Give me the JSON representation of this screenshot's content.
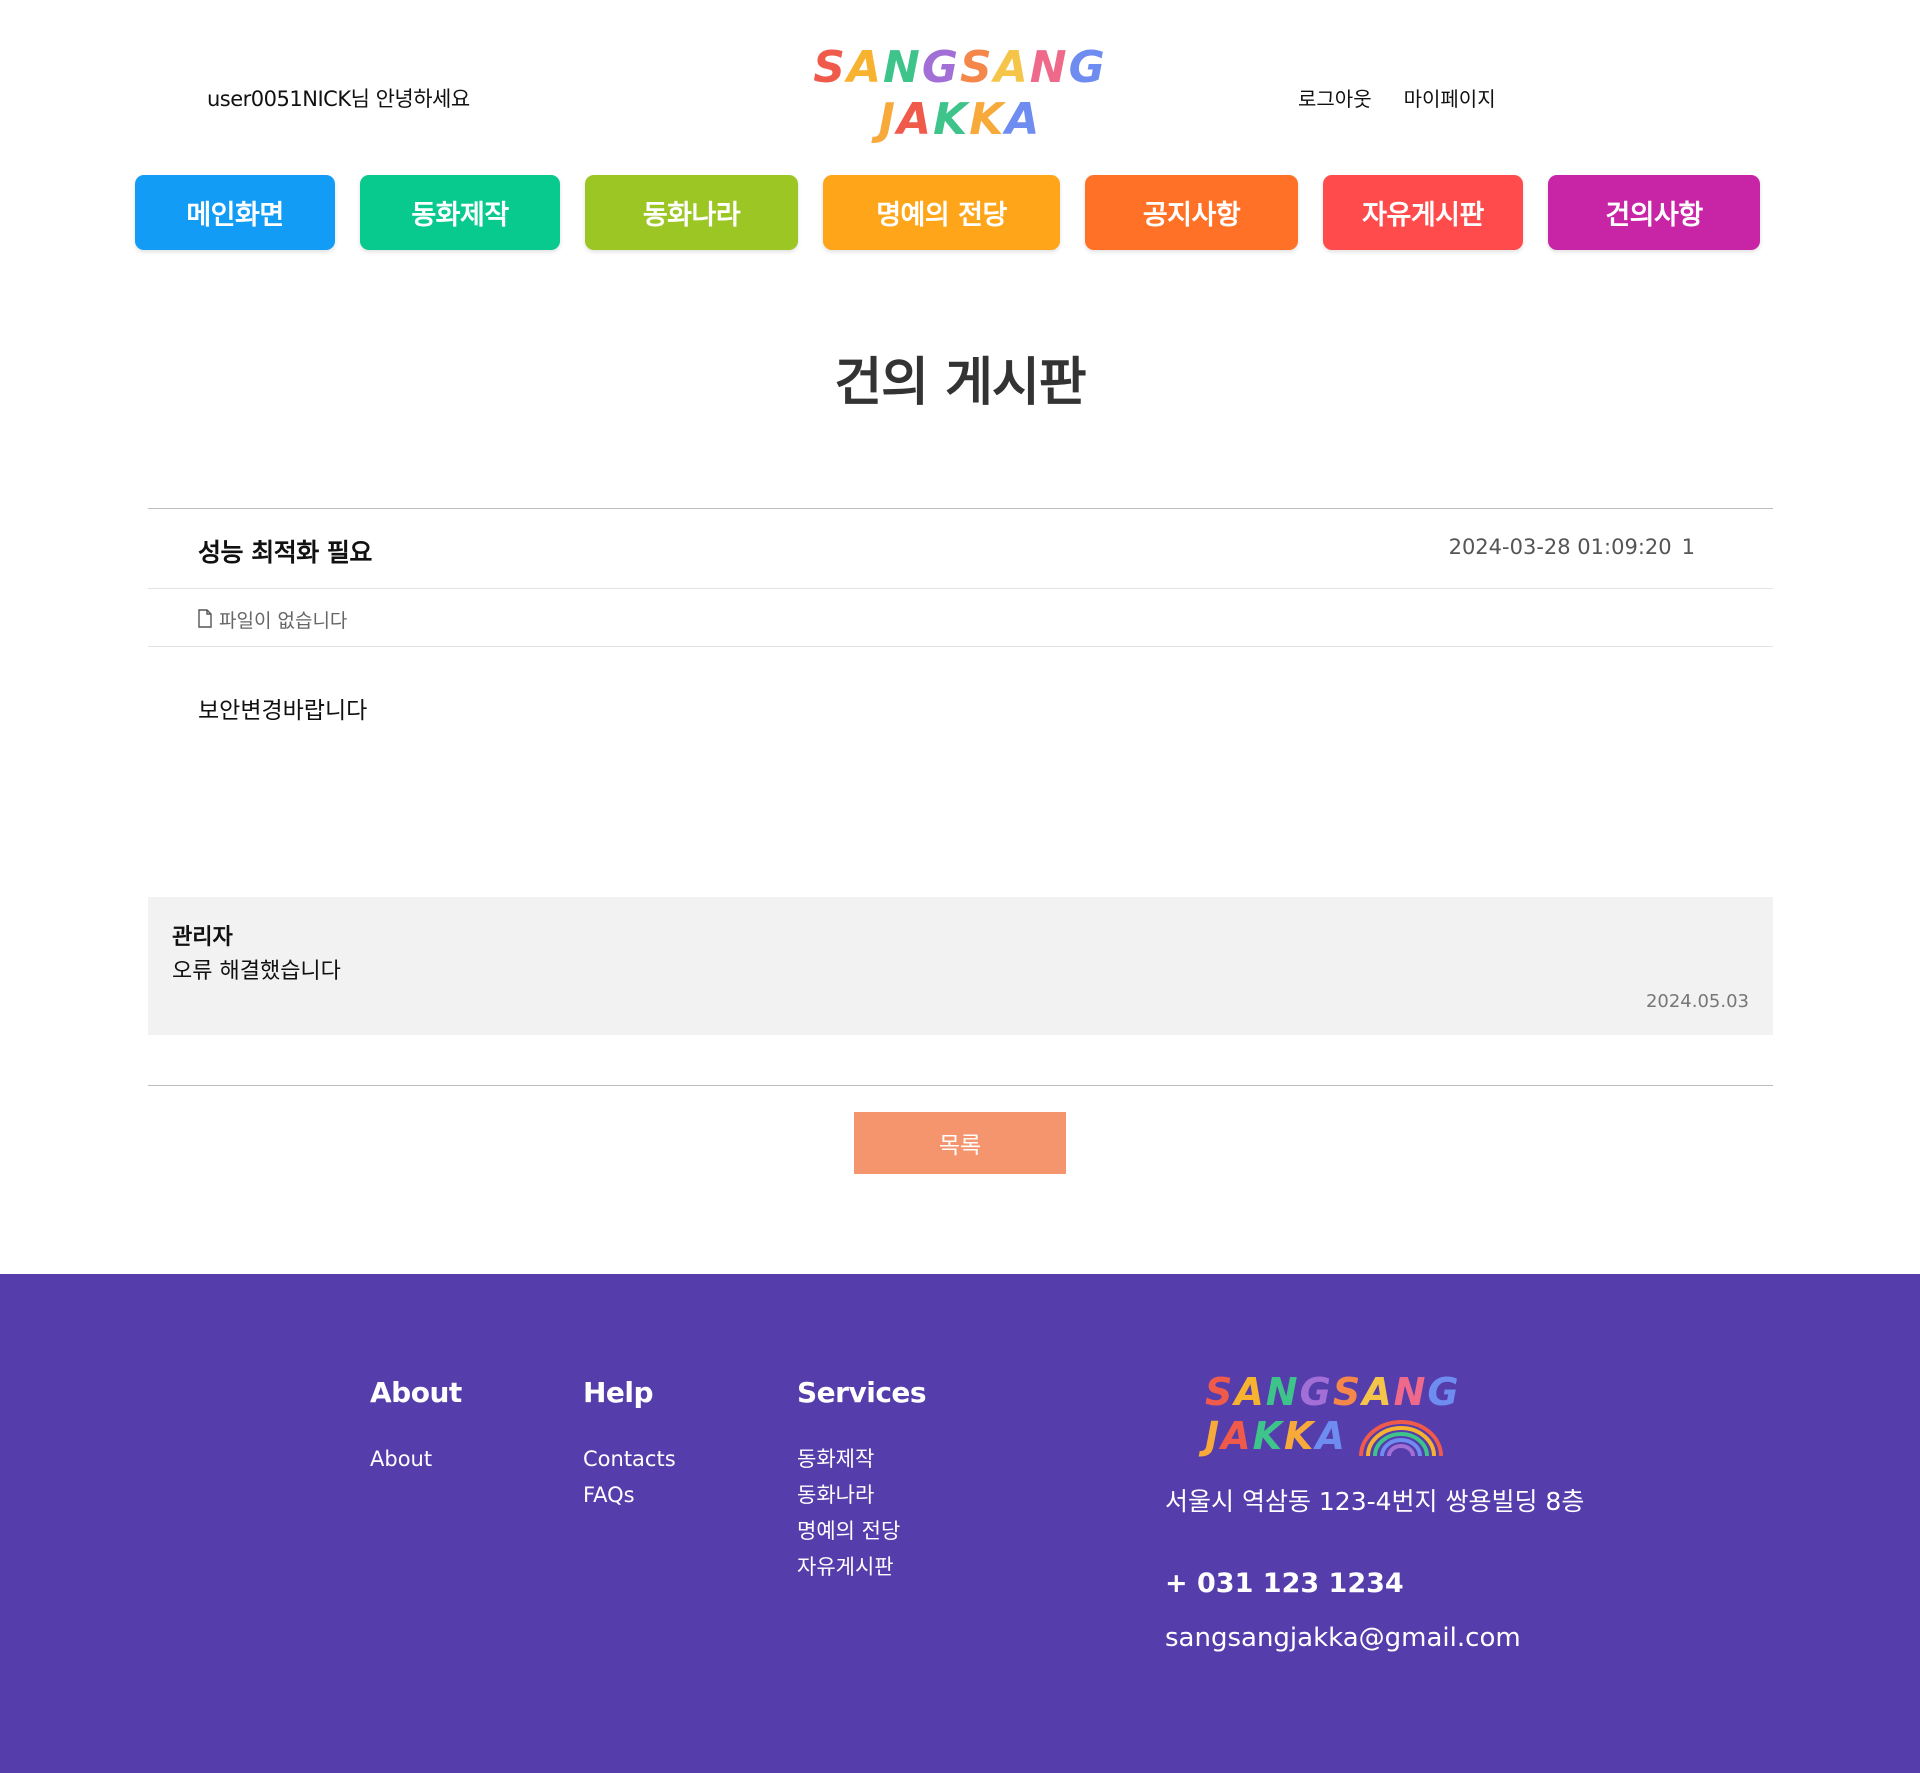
{
  "header": {
    "greeting": "user0051NICK님 안녕하세요",
    "logo": {
      "line1": [
        "S",
        "A",
        "N",
        "G",
        "S",
        "A",
        "N",
        "G"
      ],
      "line2": [
        "J",
        "A",
        "K",
        "K",
        "A"
      ],
      "line1_colors": [
        "#f05a4b",
        "#f7b230",
        "#3ec38a",
        "#a26fd6",
        "#f5874a",
        "#f5c54a",
        "#ef6a8a",
        "#6f8cf0"
      ],
      "line2_colors": [
        "#f7a93a",
        "#f05a4b",
        "#3ec38a",
        "#f7a93a",
        "#6f8cf0"
      ]
    },
    "logout_label": "로그아웃",
    "mypage_label": "마이페이지"
  },
  "nav": {
    "items": [
      {
        "label": "메인화면",
        "color": "#129cf6"
      },
      {
        "label": "동화제작",
        "color": "#08c98e"
      },
      {
        "label": "동화나라",
        "color": "#9bc624"
      },
      {
        "label": "명예의 전당",
        "color": "#ffa51a"
      },
      {
        "label": "공지사항",
        "color": "#ff7126"
      },
      {
        "label": "자유게시판",
        "color": "#ff4b4b"
      },
      {
        "label": "건의사항",
        "color": "#c824a6"
      }
    ]
  },
  "page_title": "건의 게시판",
  "post": {
    "title": "성능 최적화 필요",
    "datetime": "2024-03-28 01:09:20",
    "views": "1",
    "file_label": "파일이 없습니다",
    "content": "보안변경바랍니다"
  },
  "comment": {
    "author": "관리자",
    "text": "오류 해결했습니다",
    "date": "2024.05.03"
  },
  "list_button_label": "목록",
  "footer": {
    "about": {
      "heading": "About",
      "links": [
        "About"
      ]
    },
    "help": {
      "heading": "Help",
      "links": [
        "Contacts",
        "FAQs"
      ]
    },
    "services": {
      "heading": "Services",
      "links": [
        "동화제작",
        "동화나라",
        "명예의 전당",
        "자유게시판"
      ]
    },
    "address": "서울시 역삼동 123-4번지 쌍용빌딩 8층",
    "phone": "+ 031 123 1234",
    "email": "sangsangjakka@gmail.com",
    "background_color": "#553dab"
  }
}
